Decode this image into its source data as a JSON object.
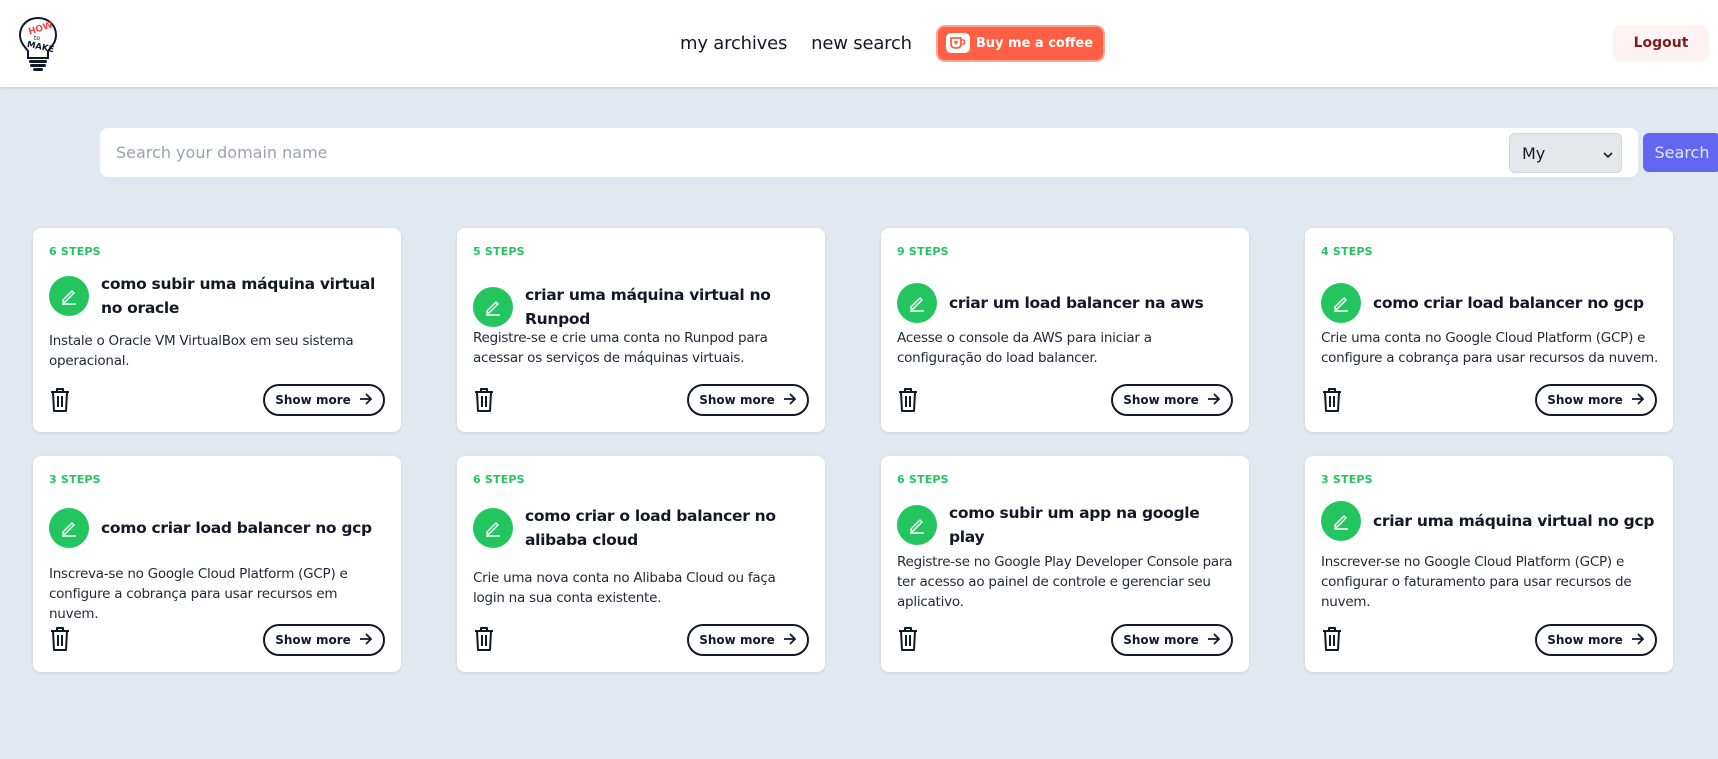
{
  "header": {
    "logo_text": "HOW to MAKE",
    "nav": {
      "archives_label": "my archives",
      "new_search_label": "new search",
      "coffee_label": "Buy me a coffee"
    },
    "logout_label": "Logout"
  },
  "search": {
    "placeholder": "Search your domain name",
    "value": "",
    "select_value": "My",
    "button_label": "Search"
  },
  "cards": [
    {
      "steps": "6 STEPS",
      "title": "como subir uma máquina virtual no oracle",
      "description": "Instale o Oracle VM VirtualBox em seu sistema operacional.",
      "show_more": "Show more"
    },
    {
      "steps": "5 STEPS",
      "title": "criar uma máquina virtual no Runpod",
      "description": "Registre-se e crie uma conta no Runpod para acessar os serviços de máquinas virtuais.",
      "show_more": "Show more"
    },
    {
      "steps": "9 STEPS",
      "title": "criar um load balancer na aws",
      "description": "Acesse o console da AWS para iniciar a configuração do load balancer.",
      "show_more": "Show more"
    },
    {
      "steps": "4 STEPS",
      "title": "como criar load balancer no gcp",
      "description": "Crie uma conta no Google Cloud Platform (GCP) e configure a cobrança para usar recursos da nuvem.",
      "show_more": "Show more"
    },
    {
      "steps": "3 STEPS",
      "title": "como criar load balancer no gcp",
      "description": "Inscreva-se no Google Cloud Platform (GCP) e configure a cobrança para usar recursos em nuvem.",
      "show_more": "Show more"
    },
    {
      "steps": "6 STEPS",
      "title": "como criar o load balancer no alibaba cloud",
      "description": "Crie uma nova conta no Alibaba Cloud ou faça login na sua conta existente.",
      "show_more": "Show more"
    },
    {
      "steps": "6 STEPS",
      "title": "como subir um app na google play",
      "description": "Registre-se no Google Play Developer Console para ter acesso ao painel de controle e gerenciar seu aplicativo.",
      "show_more": "Show more"
    },
    {
      "steps": "3 STEPS",
      "title": "criar uma máquina virtual no gcp",
      "description": "Inscrever-se no Google Cloud Platform (GCP) e configurar o faturamento para usar recursos de nuvem.",
      "show_more": "Show more"
    }
  ],
  "colors": {
    "accent_green": "#22c55e",
    "search_button": "#6366f1",
    "coffee_button": "#ff5f45",
    "background": "#e2e8f0"
  },
  "icons": {
    "logo": "lightbulb-logo-icon",
    "edit": "pencil-icon",
    "delete": "trash-icon",
    "arrow": "arrow-right-icon",
    "coffee": "coffee-cup-icon",
    "select": "chevron-down-icon"
  }
}
